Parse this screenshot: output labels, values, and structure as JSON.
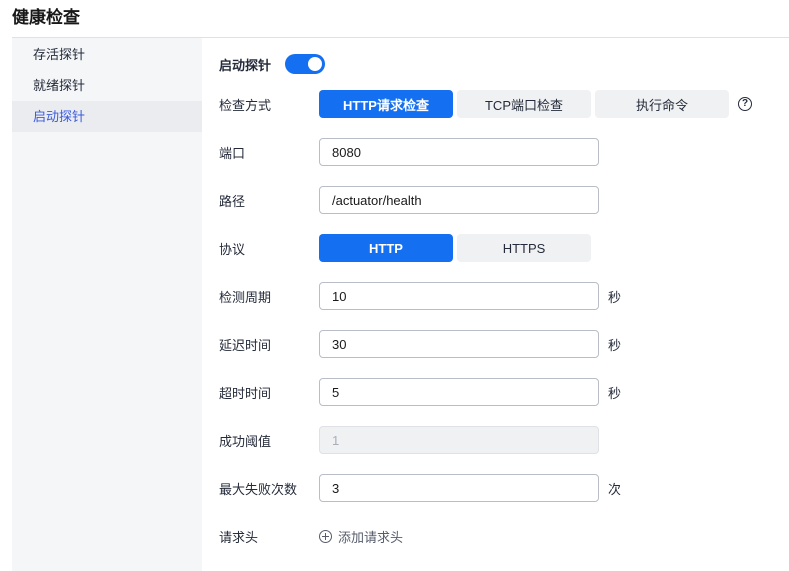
{
  "page": {
    "title": "健康检查"
  },
  "sidebar": {
    "items": [
      {
        "label": "存活探针"
      },
      {
        "label": "就绪探针"
      },
      {
        "label": "启动探针"
      }
    ]
  },
  "form": {
    "enable_label": "启动探针",
    "enabled": true,
    "check_method": {
      "label": "检查方式",
      "options": [
        "HTTP请求检查",
        "TCP端口检查",
        "执行命令"
      ],
      "selected": "HTTP请求检查"
    },
    "port": {
      "label": "端口",
      "value": "8080"
    },
    "path": {
      "label": "路径",
      "value": "/actuator/health"
    },
    "protocol": {
      "label": "协议",
      "options": [
        "HTTP",
        "HTTPS"
      ],
      "selected": "HTTP"
    },
    "period": {
      "label": "检测周期",
      "value": "10",
      "unit": "秒"
    },
    "delay": {
      "label": "延迟时间",
      "value": "30",
      "unit": "秒"
    },
    "timeout": {
      "label": "超时时间",
      "value": "5",
      "unit": "秒"
    },
    "success_threshold": {
      "label": "成功阈值",
      "value": "1"
    },
    "max_failures": {
      "label": "最大失败次数",
      "value": "3",
      "unit": "次"
    },
    "headers": {
      "label": "请求头",
      "add_label": "添加请求头"
    }
  },
  "colors": {
    "accent": "#1470f0",
    "sidebar_bg": "#f5f6f8"
  }
}
